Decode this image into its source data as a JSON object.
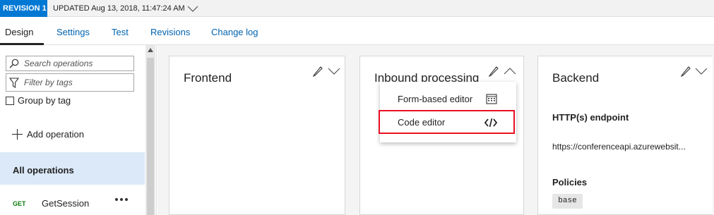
{
  "revision_bar": {
    "badge": "REVISION 1",
    "updated": "UPDATED Aug 13, 2018, 11:47:24 AM"
  },
  "tabs": [
    {
      "label": "Design",
      "active": true
    },
    {
      "label": "Settings"
    },
    {
      "label": "Test"
    },
    {
      "label": "Revisions"
    },
    {
      "label": "Change log"
    }
  ],
  "sidebar": {
    "search_placeholder": "Search operations",
    "filter_placeholder": "Filter by tags",
    "group_by_tag": "Group by tag",
    "add_operation": "Add operation",
    "all_operations": "All operations",
    "operations": [
      {
        "method": "GET",
        "name": "GetSession"
      }
    ]
  },
  "cards": {
    "frontend": {
      "title": "Frontend"
    },
    "inbound": {
      "title": "Inbound processing"
    },
    "backend": {
      "title": "Backend",
      "endpoint_label": "HTTP(s) endpoint",
      "endpoint_value": "https://conferenceapi.azurewebsit...",
      "policies_label": "Policies",
      "policy_tag": "base"
    }
  },
  "dropdown": {
    "items": [
      {
        "label": "Form-based editor",
        "icon": "form-editor-icon"
      },
      {
        "label": "Code editor",
        "icon": "code-editor-icon",
        "highlighted": true
      }
    ]
  },
  "colors": {
    "accent": "#0078d4",
    "link": "#0063b1",
    "selected_row": "#dbe9f8",
    "get_method": "#107c10",
    "highlight": "#e81123"
  }
}
